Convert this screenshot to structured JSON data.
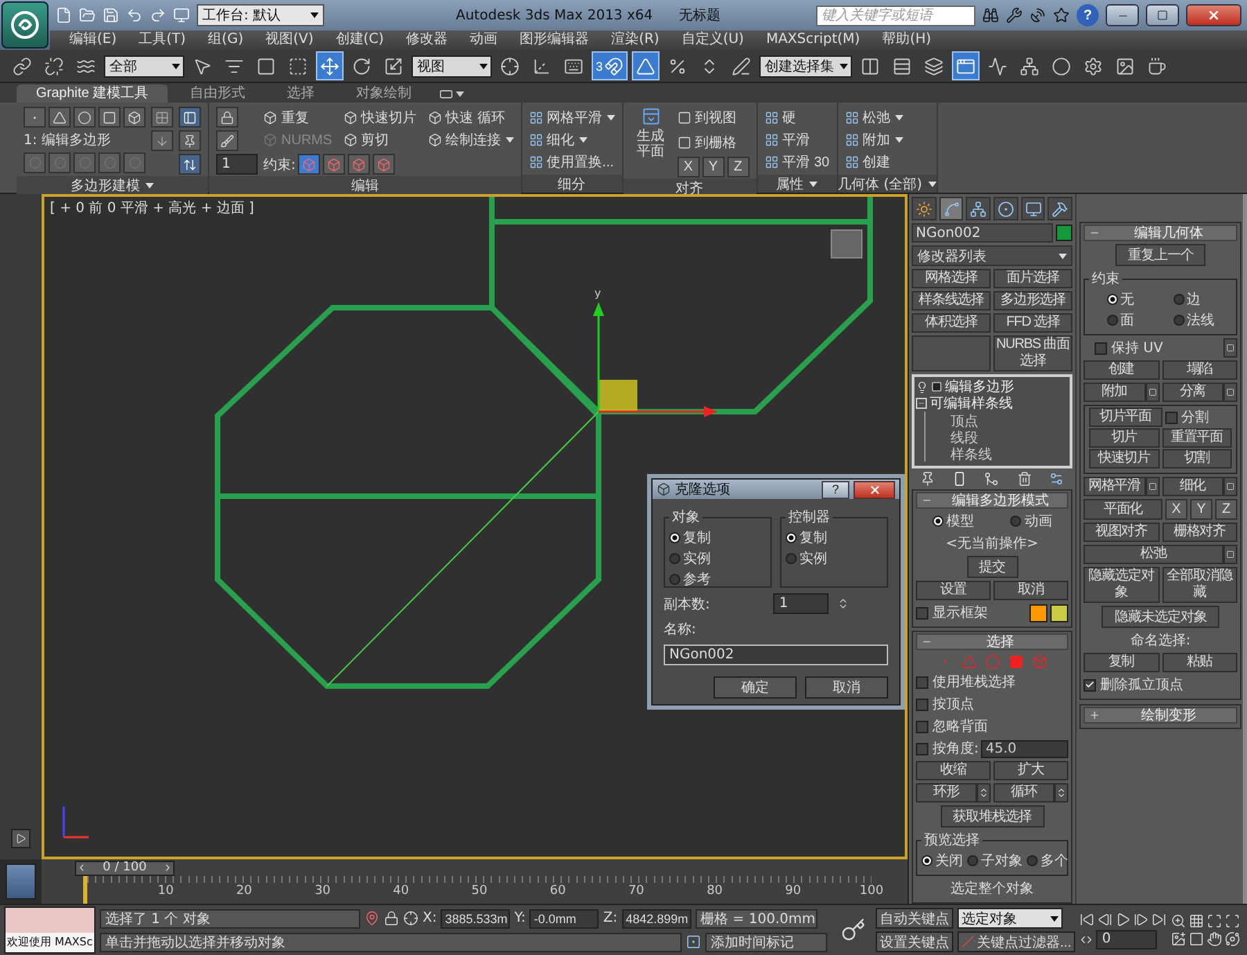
{
  "title_bar": {
    "workspace": "工作台: 默认",
    "app_title": "Autodesk 3ds Max  2013 x64",
    "document": "无标题",
    "search_placeholder": "键入关键字或短语",
    "help": "?"
  },
  "menu": [
    "编辑(E)",
    "工具(T)",
    "组(G)",
    "视图(V)",
    "创建(C)",
    "修改器",
    "动画",
    "图形编辑器",
    "渲染(R)",
    "自定义(U)",
    "MAXScript(M)",
    "帮助(H)"
  ],
  "toolbar": {
    "items": [
      {
        "kind": "tool",
        "selected": false
      },
      {
        "kind": "tool",
        "selected": false
      },
      {
        "kind": "tool",
        "selected": false
      },
      {
        "kind": "dropdown",
        "value": "全部"
      },
      {
        "kind": "tool",
        "selected": false
      },
      {
        "kind": "tool",
        "selected": false
      },
      {
        "kind": "tool",
        "selected": false
      },
      {
        "kind": "tool",
        "selected": false
      },
      {
        "kind": "tool",
        "selected": true
      },
      {
        "kind": "tool",
        "selected": false
      },
      {
        "kind": "tool",
        "selected": false
      },
      {
        "kind": "dropdown",
        "value": "视图"
      },
      {
        "kind": "tool",
        "selected": false
      },
      {
        "kind": "tool",
        "selected": false
      },
      {
        "kind": "tool",
        "selected": false
      },
      {
        "kind": "tool",
        "selected": true,
        "label": "3"
      },
      {
        "kind": "tool",
        "selected": true
      },
      {
        "kind": "tool",
        "selected": false
      },
      {
        "kind": "tool",
        "selected": false
      },
      {
        "kind": "tool",
        "selected": false
      },
      {
        "kind": "dropdown",
        "value": "创建选择集"
      },
      {
        "kind": "tool",
        "selected": false
      },
      {
        "kind": "tool",
        "selected": false
      },
      {
        "kind": "tool",
        "selected": false
      },
      {
        "kind": "tool",
        "selected": true
      },
      {
        "kind": "tool",
        "selected": false
      },
      {
        "kind": "tool",
        "selected": false
      },
      {
        "kind": "tool",
        "selected": false
      },
      {
        "kind": "tool",
        "selected": false
      },
      {
        "kind": "tool",
        "selected": false
      },
      {
        "kind": "tool",
        "selected": false
      }
    ]
  },
  "ribbon": {
    "tabs": [
      {
        "label": "Graphite 建模工具",
        "selected": true
      },
      {
        "label": "自由形式",
        "selected": false
      },
      {
        "label": "选择",
        "selected": false
      },
      {
        "label": "对象绘制",
        "selected": false
      }
    ],
    "groups": [
      {
        "kind": "polymodel",
        "label": "多边形建模",
        "has_menu": true,
        "stack": "1: 编辑多边形"
      },
      {
        "kind": "edit",
        "label": "编辑",
        "has_menu": false,
        "spinner": "1",
        "constraint_label": "约束:",
        "constraints": [
          {
            "selected": true
          },
          {
            "selected": false
          },
          {
            "selected": false
          },
          {
            "selected": false
          }
        ],
        "items": [
          {
            "label": "重复",
            "disabled": false,
            "has_menu": false
          },
          {
            "label": "NURMS",
            "disabled": true,
            "has_menu": false
          },
          {
            "label": "快速切片",
            "disabled": false,
            "has_menu": false
          },
          {
            "label": "剪切",
            "disabled": false,
            "has_menu": false
          },
          {
            "label": "快速 循环",
            "disabled": false,
            "has_menu": false
          },
          {
            "label": "绘制连接",
            "disabled": false,
            "has_menu": true
          }
        ]
      },
      {
        "kind": "list",
        "label": "细分",
        "has_menu": false,
        "items": [
          {
            "label": "网格平滑",
            "has_menu": true
          },
          {
            "label": "细化",
            "has_menu": true
          },
          {
            "label": "使用置换...",
            "has_menu": false
          }
        ]
      },
      {
        "kind": "align",
        "label": "对齐",
        "has_menu": false,
        "big": "生成平面",
        "items": [
          {
            "label": "到视图"
          },
          {
            "label": "到栅格"
          }
        ],
        "axes": [
          "X",
          "Y",
          "Z"
        ]
      },
      {
        "kind": "list",
        "label": "属性",
        "has_menu": true,
        "items": [
          {
            "label": "硬",
            "has_menu": false
          },
          {
            "label": "平滑",
            "has_menu": false
          },
          {
            "label": "平滑 30",
            "has_menu": false
          }
        ]
      },
      {
        "kind": "list",
        "label": "几何体 (全部)",
        "has_menu": true,
        "items": [
          {
            "label": "松弛",
            "has_menu": true
          },
          {
            "label": "附加",
            "has_menu": true
          },
          {
            "label": "创建",
            "has_menu": false
          }
        ]
      }
    ]
  },
  "viewport": {
    "label": "[ + 0 前 0 平滑 + 高光 + 边面 ]",
    "gizmo_axis": "y"
  },
  "clone_dialog": {
    "title": "克隆选项",
    "help": "?",
    "groups": [
      {
        "title": "对象",
        "options": [
          {
            "label": "复制",
            "selected": true
          },
          {
            "label": "实例",
            "selected": false
          },
          {
            "label": "参考",
            "selected": false
          }
        ]
      },
      {
        "title": "控制器",
        "options": [
          {
            "label": "复制",
            "selected": true
          },
          {
            "label": "实例",
            "selected": false
          }
        ]
      }
    ],
    "copies_label": "副本数:",
    "copies": "1",
    "name_label": "名称:",
    "name": "NGon002",
    "buttons": [
      "确定",
      "取消"
    ]
  },
  "command_panel": {
    "tabs": [
      {
        "selected": false
      },
      {
        "selected": true
      },
      {
        "selected": false
      },
      {
        "selected": false
      },
      {
        "selected": false
      },
      {
        "selected": false
      }
    ],
    "object": {
      "name": "NGon002",
      "color": "#14993a"
    },
    "modifier_list": "修改器列表",
    "modifier_buttons": [
      {
        "kind": "button",
        "label": "网格选择"
      },
      {
        "kind": "button",
        "label": "面片选择"
      },
      {
        "kind": "button",
        "label": "样条线选择"
      },
      {
        "kind": "button",
        "label": "多边形选择"
      },
      {
        "kind": "button",
        "label": "体积选择"
      },
      {
        "kind": "button",
        "label": "FFD 选择"
      },
      {
        "kind": "blank"
      },
      {
        "kind": "button",
        "label": "NURBS 曲面选择"
      }
    ],
    "stack": [
      {
        "label": "编辑多边形"
      },
      {
        "label": "可编辑样条线",
        "expanded": true,
        "children": [
          {
            "label": "顶点"
          },
          {
            "label": "线段"
          },
          {
            "label": "样条线"
          }
        ]
      }
    ],
    "left_rollouts": [
      {
        "title": "编辑多边形模式",
        "expanded": true,
        "controls": [
          {
            "kind": "radios",
            "options": [
              {
                "label": "模型",
                "selected": true
              },
              {
                "label": "动画",
                "selected": false
              }
            ]
          },
          {
            "kind": "text",
            "text": "<无当前操作>"
          },
          {
            "kind": "buttons",
            "buttons": [
              {
                "label": "提交"
              }
            ]
          },
          {
            "kind": "buttons",
            "buttons": [
              {
                "label": "设置"
              },
              {
                "label": "取消"
              }
            ]
          },
          {
            "kind": "swatches",
            "label": "显示框架",
            "checked": false,
            "swatches": [
              {
                "color": "#ff9900"
              },
              {
                "color": "#cccc44"
              }
            ]
          }
        ]
      },
      {
        "title": "选择",
        "expanded": true,
        "controls": [
          {
            "kind": "icons"
          },
          {
            "kind": "checkbox",
            "label": "使用堆栈选择",
            "checked": false
          },
          {
            "kind": "checkbox",
            "label": "按顶点",
            "checked": false
          },
          {
            "kind": "checkbox",
            "label": "忽略背面",
            "checked": false
          },
          {
            "kind": "checkbox_field",
            "label": "按角度:",
            "checked": false,
            "value": "45.0"
          },
          {
            "kind": "buttons",
            "buttons": [
              {
                "label": "收缩"
              },
              {
                "label": "扩大"
              }
            ]
          },
          {
            "kind": "buttons",
            "buttons": [
              {
                "label": "环形",
                "spinner": true
              },
              {
                "label": "循环",
                "spinner": true
              }
            ]
          },
          {
            "kind": "buttons",
            "buttons": [
              {
                "label": "获取堆栈选择"
              }
            ]
          },
          {
            "kind": "group",
            "title": "预览选择",
            "controls": [
              {
                "kind": "radios",
                "options": [
                  {
                    "label": "关闭",
                    "selected": true
                  },
                  {
                    "label": "子对象",
                    "selected": false
                  },
                  {
                    "label": "多个",
                    "selected": false
                  }
                ]
              }
            ]
          },
          {
            "kind": "text",
            "text": "选定整个对象"
          }
        ]
      }
    ],
    "right_rollouts": [
      {
        "title": "编辑几何体",
        "expanded": true,
        "controls": [
          {
            "kind": "buttons",
            "buttons": [
              {
                "label": "重复上一个"
              }
            ]
          },
          {
            "kind": "group",
            "title": "约束",
            "controls": [
              {
                "kind": "radios",
                "options": [
                  {
                    "label": "无",
                    "selected": true
                  },
                  {
                    "label": "边",
                    "selected": false
                  },
                  {
                    "label": "面",
                    "selected": false
                  },
                  {
                    "label": "法线",
                    "selected": false
                  }
                ]
              }
            ]
          },
          {
            "kind": "checkbox_settings",
            "label": "保持 UV",
            "checked": false
          },
          {
            "kind": "buttons",
            "buttons": [
              {
                "label": "创建"
              },
              {
                "label": "塌陷"
              }
            ]
          },
          {
            "kind": "buttons",
            "buttons": [
              {
                "label": "附加",
                "settings": true
              },
              {
                "label": "分离",
                "settings": true
              }
            ]
          },
          {
            "kind": "group",
            "controls": [
              {
                "kind": "button_check",
                "button": "切片平面",
                "label": "分割",
                "checked": false
              },
              {
                "kind": "buttons",
                "buttons": [
                  {
                    "label": "切片"
                  },
                  {
                    "label": "重置平面"
                  }
                ]
              },
              {
                "kind": "buttons",
                "buttons": [
                  {
                    "label": "快速切片"
                  },
                  {
                    "label": "切割"
                  }
                ]
              }
            ]
          },
          {
            "kind": "buttons",
            "buttons": [
              {
                "label": "网格平滑",
                "settings": true
              },
              {
                "label": "细化",
                "settings": true
              }
            ]
          },
          {
            "kind": "axis_buttons",
            "button": "平面化",
            "axes": [
              "X",
              "Y",
              "Z"
            ]
          },
          {
            "kind": "buttons",
            "buttons": [
              {
                "label": "视图对齐"
              },
              {
                "label": "栅格对齐"
              }
            ]
          },
          {
            "kind": "buttons",
            "buttons": [
              {
                "label": "松弛",
                "settings": true
              }
            ]
          },
          {
            "kind": "buttons",
            "buttons": [
              {
                "label": "隐藏选定对象"
              },
              {
                "label": "全部取消隐藏"
              }
            ]
          },
          {
            "kind": "buttons",
            "buttons": [
              {
                "label": "隐藏未选定对象"
              }
            ]
          },
          {
            "kind": "text",
            "text": "命名选择:"
          },
          {
            "kind": "buttons",
            "buttons": [
              {
                "label": "复制"
              },
              {
                "label": "粘贴"
              }
            ]
          },
          {
            "kind": "checkbox",
            "label": "删除孤立顶点",
            "checked": true
          }
        ]
      },
      {
        "title": "绘制变形",
        "expanded": false
      }
    ]
  },
  "timeline": {
    "slider": "0 / 100",
    "level": 0,
    "ticks": [
      "10",
      "20",
      "30",
      "40",
      "50",
      "60",
      "70",
      "80",
      "90",
      "100"
    ]
  },
  "status_bar": {
    "welcome": "欢迎使用 MAXSc",
    "selection": "选择了 1 个 对象",
    "prompt": "单击并拖动以选择并移动对象",
    "coords": [
      {
        "axis": "X:",
        "value": "3885.533m"
      },
      {
        "axis": "Y:",
        "value": "-0.0mm"
      },
      {
        "axis": "Z:",
        "value": "4842.899m"
      }
    ],
    "grid": "栅格 = 100.0mm",
    "add_time_tag": "添加时间标记",
    "auto_key": "自动关键点",
    "key_mode": "选定对象",
    "set_key": "设置关键点",
    "key_filters": "关键点过滤器...",
    "frame": "0"
  }
}
